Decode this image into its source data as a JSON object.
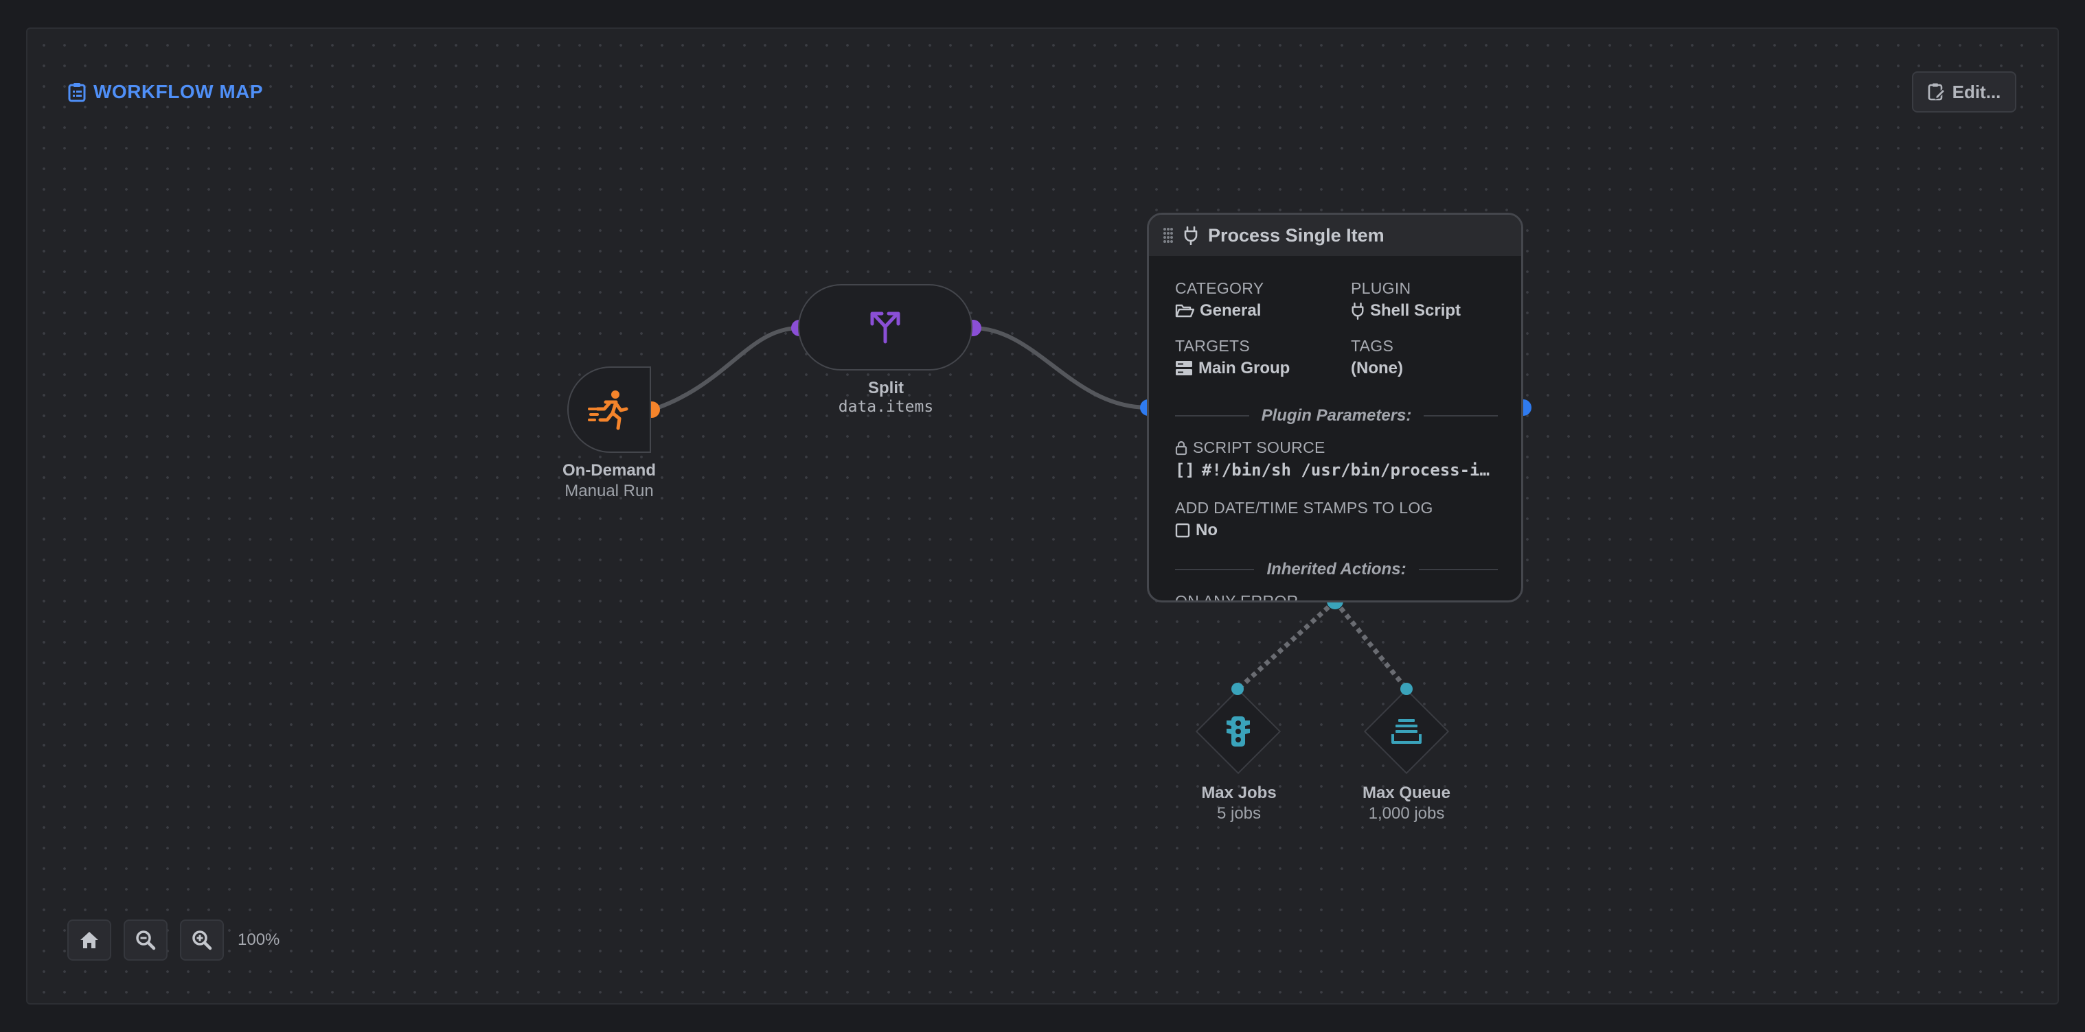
{
  "header": {
    "title": "WORKFLOW MAP",
    "edit_label": "Edit..."
  },
  "nodes": {
    "trigger": {
      "title": "On-Demand",
      "subtitle": "Manual Run",
      "color": "#f5842b"
    },
    "split": {
      "title": "Split",
      "expression": "data.items",
      "color": "#8a4fd6"
    },
    "job": {
      "title": "Process Single Item",
      "category_label": "CATEGORY",
      "category_value": "General",
      "plugin_label": "PLUGIN",
      "plugin_value": "Shell Script",
      "targets_label": "TARGETS",
      "targets_value": "Main Group",
      "tags_label": "TAGS",
      "tags_value": "(None)",
      "params_heading": "Plugin Parameters:",
      "script_label": "SCRIPT SOURCE",
      "script_brackets": "[]",
      "script_value": "#!/bin/sh /usr/bin/process-i…",
      "timestamps_label": "ADD DATE/TIME STAMPS TO LOG",
      "timestamps_value": "No",
      "inherited_heading": "Inherited Actions:",
      "error_label": "ON ANY ERROR",
      "port_color": "#2f7bf0"
    },
    "limits": [
      {
        "title": "Max Jobs",
        "value": "5 jobs",
        "icon": "traffic-light-icon"
      },
      {
        "title": "Max Queue",
        "value": "1,000 jobs",
        "icon": "queue-stack-icon"
      }
    ],
    "limit_color": "#3aa3bb"
  },
  "zoom": {
    "level": "100%"
  }
}
